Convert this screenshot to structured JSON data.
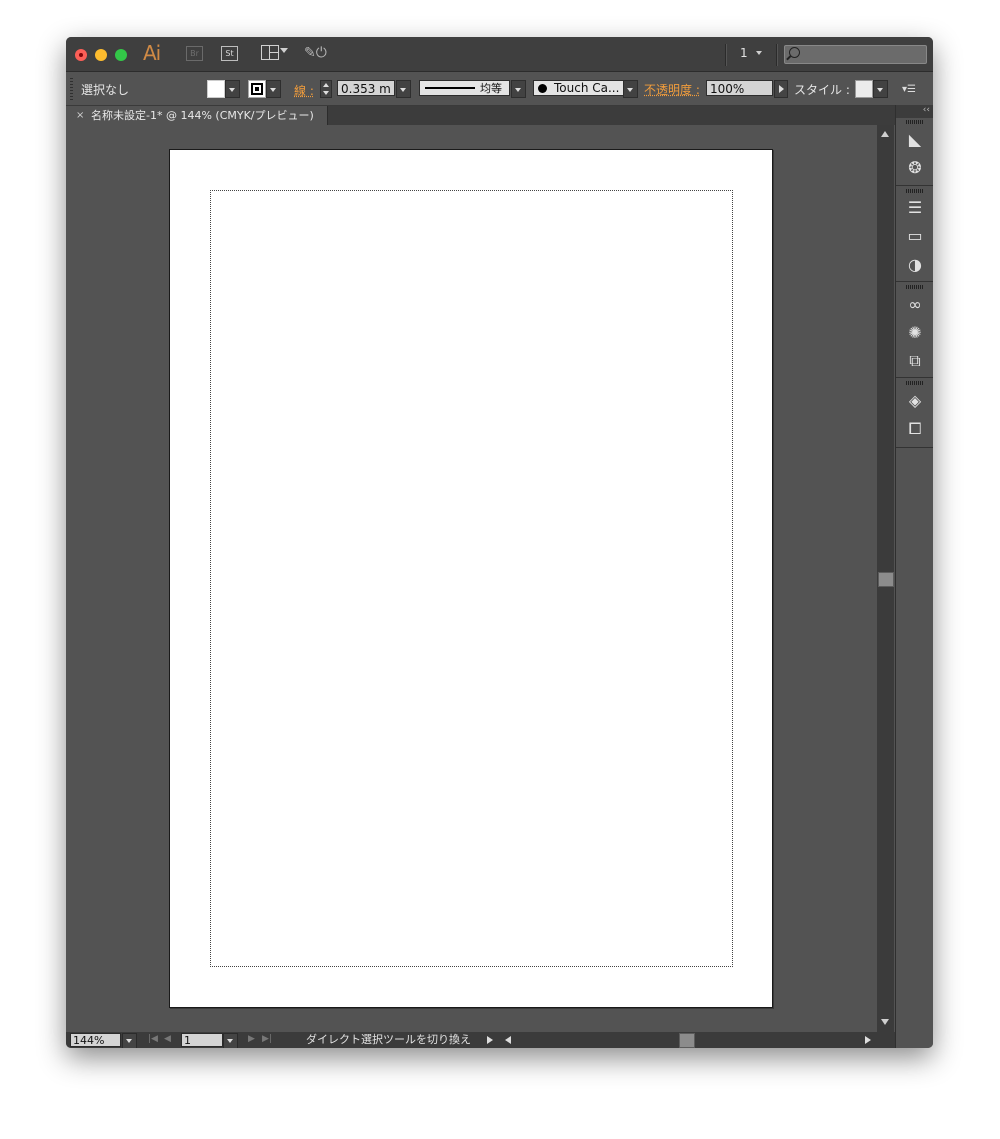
{
  "app": {
    "logo": "Ai",
    "bridge": "Br",
    "stock": "St"
  },
  "titlebar": {
    "page_number": "1",
    "search_placeholder": ""
  },
  "control_bar": {
    "selection": "選択なし",
    "stroke_label": "線 :",
    "stroke_weight": "0.353 m",
    "profile_label": "均等",
    "brush_label": "Touch Ca...",
    "opacity_label": "不透明度 :",
    "opacity_value": "100%",
    "style_label": "スタイル :"
  },
  "document_tab": {
    "close": "×",
    "title": "名称未設定-1* @ 144% (CMYK/プレビュー)"
  },
  "status_bar": {
    "zoom": "144%",
    "artboard": "1",
    "tool": "ダイレクト選択ツールを切り換え"
  },
  "dock": {
    "collapse": "‹‹",
    "icons": [
      "color-guide-icon",
      "symbols-icon",
      "stroke-icon",
      "gradient-icon",
      "transparency-icon",
      "cc-libraries-icon",
      "appearance-icon",
      "asset-export-icon",
      "layers-icon",
      "artboards-icon"
    ]
  },
  "colors": {
    "accent": "#f29d3c",
    "window_bg": "#535353",
    "titlebar_bg": "#3f3f3f"
  }
}
